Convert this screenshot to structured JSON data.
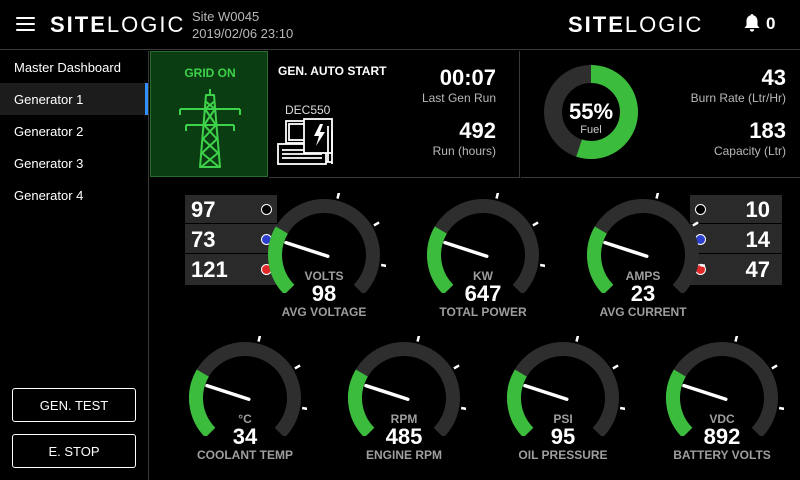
{
  "header": {
    "brand_bold": "SITE",
    "brand_light": "LOGIC",
    "site_id": "Site W0045",
    "datetime": "2019/02/06 23:10",
    "notification_count": "0"
  },
  "sidebar": {
    "items": [
      {
        "label": "Master Dashboard",
        "active": false
      },
      {
        "label": "Generator 1",
        "active": true
      },
      {
        "label": "Generator 2",
        "active": false
      },
      {
        "label": "Generator 3",
        "active": false
      },
      {
        "label": "Generator 4",
        "active": false
      }
    ],
    "gen_test_label": "GEN. TEST",
    "estop_label": "E. STOP"
  },
  "grid": {
    "status": "GRID ON"
  },
  "autostart": {
    "title": "GEN. AUTO START",
    "controller": "DEC550",
    "last_run_value": "00:07",
    "last_run_label": "Last Gen Run",
    "run_hours_value": "492",
    "run_hours_label": "Run (hours)"
  },
  "fuel": {
    "percent": 55,
    "percent_text": "55%",
    "label": "Fuel",
    "burn_rate_value": "43",
    "burn_rate_label": "Burn Rate (Ltr/Hr)",
    "capacity_value": "183",
    "capacity_label": "Capacity (Ltr)"
  },
  "phases_voltage": [
    "97",
    "73",
    "121"
  ],
  "phases_current": [
    "10",
    "14",
    "47"
  ],
  "phase_colors": [
    "#000000",
    "#2d3fcf",
    "#e02a2a"
  ],
  "colors": {
    "accent_green": "#3cbc3c",
    "gauge_track": "#2e2e2e",
    "active_indicator": "#2f8fff"
  },
  "gauges": [
    {
      "id": "voltage",
      "unit": "VOLTS",
      "value": "98",
      "title": "AVG VOLTAGE",
      "level": 0.28
    },
    {
      "id": "power",
      "unit": "KW",
      "value": "647",
      "title": "TOTAL POWER",
      "level": 0.28
    },
    {
      "id": "current",
      "unit": "AMPS",
      "value": "23",
      "title": "AVG CURRENT",
      "level": 0.28
    },
    {
      "id": "coolant",
      "unit": "°C",
      "value": "34",
      "title": "COOLANT TEMP",
      "level": 0.28
    },
    {
      "id": "rpm",
      "unit": "RPM",
      "value": "485",
      "title": "ENGINE RPM",
      "level": 0.28
    },
    {
      "id": "oil",
      "unit": "PSI",
      "value": "95",
      "title": "OIL PRESSURE",
      "level": 0.28
    },
    {
      "id": "battery",
      "unit": "VDC",
      "value": "892",
      "title": "BATTERY VOLTS",
      "level": 0.28
    }
  ]
}
